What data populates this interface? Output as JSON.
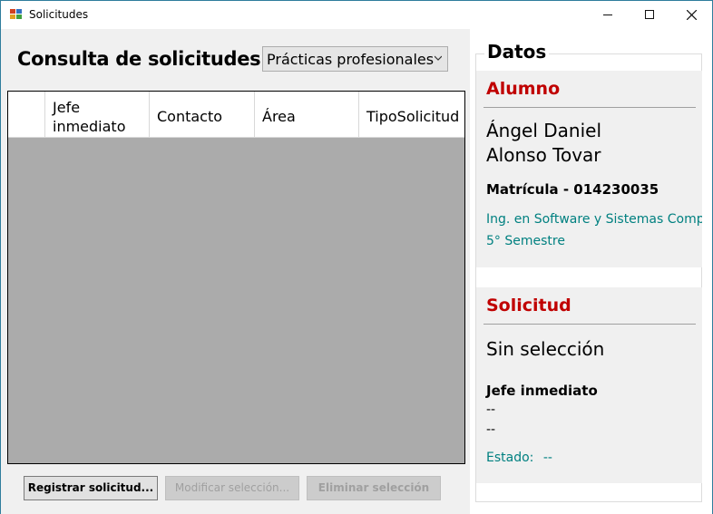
{
  "window": {
    "title": "Solicitudes",
    "controls": {
      "minimize_icon": "minimize-icon",
      "maximize_icon": "maximize-icon",
      "close_icon": "close-icon"
    }
  },
  "main": {
    "title": "Consulta de solicitudes",
    "filter_selected": "Prácticas profesionales",
    "grid": {
      "columns": [
        "Jefe inmediato",
        "Contacto",
        "Área",
        "TipoSolicitud"
      ],
      "rows": []
    },
    "buttons": {
      "register": "Registrar solicitud...",
      "modify": "Modificar selección...",
      "delete": "Eliminar selección"
    }
  },
  "details": {
    "group_title": "Datos",
    "alumno": {
      "heading": "Alumno",
      "name_line1": "Ángel Daniel",
      "name_line2": "Alonso Tovar",
      "matricula": "Matrícula - 014230035",
      "carrera": "Ing. en Software y Sistemas Compu",
      "semestre": "5° Semestre"
    },
    "solicitud": {
      "heading": "Solicitud",
      "selection": "Sin selección",
      "jefe_label": "Jefe inmediato",
      "jefe_value1": "--",
      "jefe_value2": "--",
      "estado_label": "Estado:",
      "estado_value": "--"
    }
  },
  "colors": {
    "accent_red": "#c00000",
    "teal": "#008080",
    "grid_bg": "#ababab",
    "pane_bg": "#f0f0f0"
  }
}
